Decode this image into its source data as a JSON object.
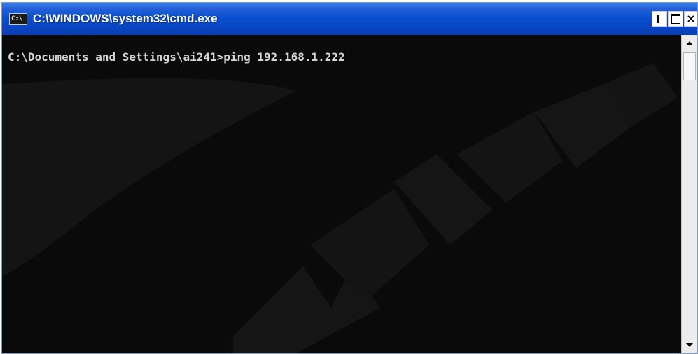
{
  "window": {
    "title": "C:\\WINDOWS\\system32\\cmd.exe",
    "icon": "cmd-icon",
    "icon_text": "C:\\",
    "controls": {
      "minimize": "minimize-icon",
      "maximize": "maximize-icon",
      "close": "close-icon",
      "close_glyph": "×"
    }
  },
  "console": {
    "lines": [
      "C:\\Documents and Settings\\ai241>ping 192.168.1.222"
    ],
    "text_color": "#d4d4d4",
    "background": "#0a0a0a"
  },
  "scrollbar": {
    "up_icon": "scroll-up-icon",
    "down_icon": "scroll-down-icon"
  },
  "colors": {
    "titlebar": "#0a4fd0"
  }
}
